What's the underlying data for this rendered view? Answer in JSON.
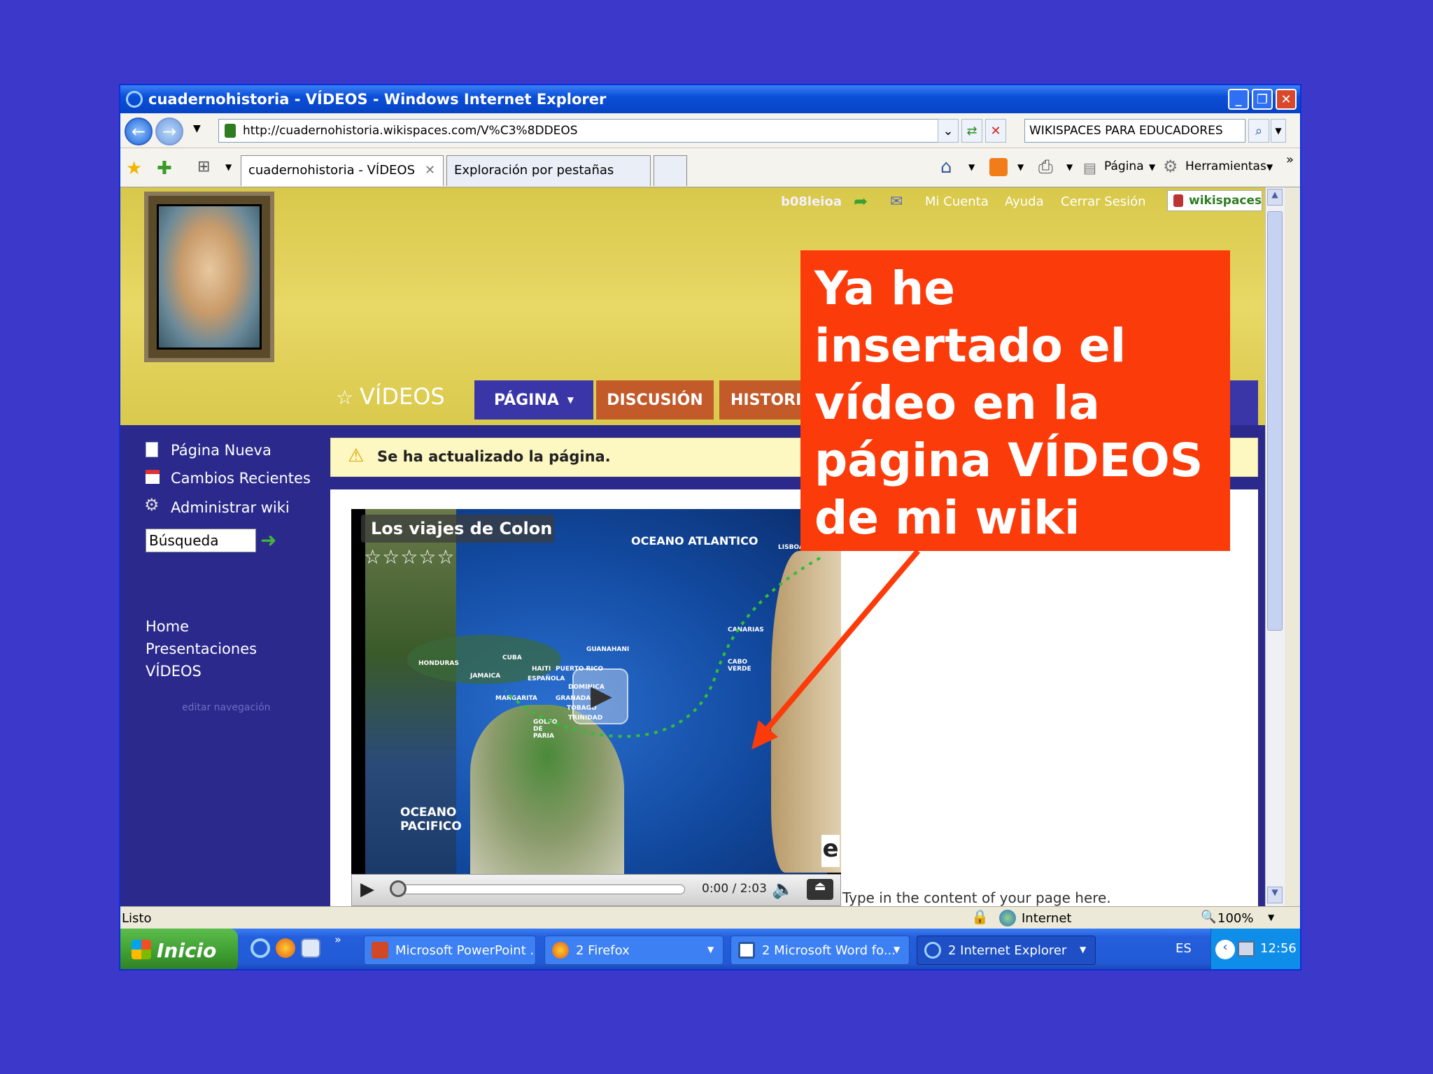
{
  "window": {
    "title": "cuadernohistoria - VÍDEOS - Windows Internet Explorer",
    "controls": [
      "_",
      "❐",
      "✕"
    ]
  },
  "navbar": {
    "url": "http://cuadernohistoria.wikispaces.com/V%C3%8DDEOS",
    "search_value": "WIKISPACES PARA EDUCADORES"
  },
  "tabs": [
    {
      "label": "cuadernohistoria - VÍDEOS",
      "close": "✕"
    },
    {
      "label": "Exploración por pestañas"
    }
  ],
  "commands": {
    "page": "Página",
    "tools": "Herramientas",
    "more": "»"
  },
  "site": {
    "user": "b08leioa",
    "links": [
      "Mi Cuenta",
      "Ayuda",
      "Cerrar Sesión"
    ],
    "brand": "wikispaces",
    "page_title": "VÍDEOS",
    "page_tabs": [
      "PÁGINA",
      "DISCUSIÓN",
      "HISTORIA"
    ],
    "notice": "Se ha actualizado la página.",
    "sidebar_actions": [
      "Página Nueva",
      "Cambios Recientes",
      "Administrar wiki"
    ],
    "search_placeholder": "Búsqueda",
    "nav": [
      "Home",
      "Presentaciones",
      "VÍDEOS"
    ],
    "edit_nav": "editar navegación",
    "content_text": "Type in the content of your page here."
  },
  "video": {
    "title": "Los viajes de Colon",
    "stars": "☆☆☆☆☆",
    "time": "0:00 / 2:03",
    "map_labels": [
      "OCEANO ATLANTICO",
      "LISBOA",
      "CANARIAS",
      "CABO VERDE",
      "GUANAHANI",
      "HONDURAS",
      "CUBA",
      "JAMAICA",
      "HAITI",
      "PUERTO RICO",
      "ESPAÑOLA",
      "DOMINICA",
      "MARGARITA",
      "GRANADA",
      "TOBAGO",
      "TRINIDAD",
      "GOLFO DE PARIA",
      "OCEANO PACIFICO"
    ]
  },
  "status": {
    "text": "Listo",
    "zone": "Internet",
    "zoom": "100%"
  },
  "taskbar": {
    "start": "Inicio",
    "tasks": [
      "Microsoft PowerPoint ...",
      "2 Firefox",
      "2 Microsoft Word fo...",
      "2 Internet Explorer"
    ],
    "lang": "ES",
    "clock": "12:56"
  },
  "callout": {
    "text": "Ya he insertado el vídeo en la página VÍDEOS de mi wiki"
  },
  "colors": {
    "desktop": "#3c38c9",
    "callout": "#fc3b0a",
    "site_bg": "#2b2a8c",
    "header": "#e8d866",
    "tab_active": "#3a36a8",
    "tab_inactive": "#c25a2a"
  }
}
